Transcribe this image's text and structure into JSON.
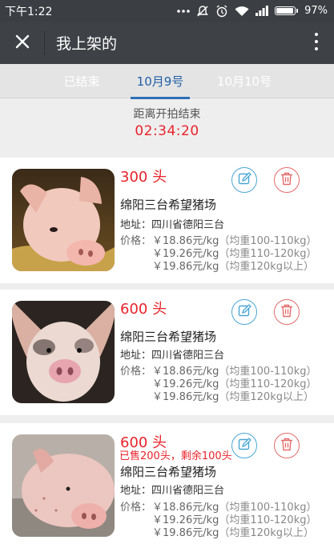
{
  "status_bar": {
    "time": "下午1:22",
    "battery": "97%"
  },
  "header": {
    "title": "我上架的"
  },
  "tabs": [
    {
      "label": "已结束",
      "active": false
    },
    {
      "label": "10月9号",
      "active": true
    },
    {
      "label": "10月10号",
      "active": false
    }
  ],
  "countdown": {
    "label": "距离开拍结束",
    "time": "02:34:20"
  },
  "listings": [
    {
      "quantity": "300 头",
      "farm": "绵阳三台希望猪场",
      "address": "地址：四川省德阳三台",
      "price_label": "价格：",
      "prices": [
        {
          "price": "￥18.86元/kg",
          "weight": "（均重100-110kg）"
        },
        {
          "price": "￥19.26元/kg",
          "weight": "（均重110-120kg）"
        },
        {
          "price": "￥19.86元/kg",
          "weight": "（均重120kg以上）"
        }
      ]
    },
    {
      "quantity": "600 头",
      "farm": "绵阳三台希望猪场",
      "address": "地址：四川省德阳三台",
      "price_label": "价格：",
      "prices": [
        {
          "price": "￥18.86元/kg",
          "weight": "（均重100-110kg）"
        },
        {
          "price": "￥19.26元/kg",
          "weight": "（均重110-120kg）"
        },
        {
          "price": "￥19.86元/kg",
          "weight": "（均重120kg以上）"
        }
      ]
    },
    {
      "quantity": "600 头",
      "sold_info": "已售200头，剩余100头",
      "farm": "绵阳三台希望猪场",
      "address": "地址：四川省德阳三台",
      "price_label": "价格：",
      "prices": [
        {
          "price": "￥18.86元/kg",
          "weight": "（均重100-110kg）"
        },
        {
          "price": "￥19.26元/kg",
          "weight": "（均重110-120kg）"
        },
        {
          "price": "￥19.86元/kg",
          "weight": "（均重120kg以上）"
        }
      ]
    }
  ],
  "icons": {
    "close": "close-icon",
    "more": "more-vertical-icon",
    "edit": "edit-icon",
    "delete": "trash-icon"
  },
  "colors": {
    "header_bg": "#3e4247",
    "accent_blue": "#2e6fb6",
    "accent_red": "#e8232b",
    "edit_ring": "#4aa6d4",
    "delete_ring": "#e56a6a"
  }
}
